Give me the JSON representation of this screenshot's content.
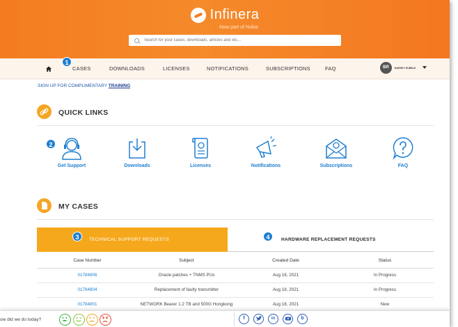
{
  "brand": {
    "logo_text": "Infinera",
    "subtitle": "Now part of Nokia"
  },
  "search": {
    "placeholder": "Search for your cases, downloads, articles and etc..."
  },
  "nav": {
    "items": [
      {
        "label": "CASES"
      },
      {
        "label": "DOWNLOADS"
      },
      {
        "label": "LICENSES"
      },
      {
        "label": "NOTIFICATIONS"
      },
      {
        "label": "SUBSCRIPTIONS"
      },
      {
        "label": "FAQ"
      }
    ],
    "user_initials": "BR",
    "user_name": "BARNEY RUBBLE"
  },
  "signup": {
    "text": "SIGN UP FOR COMPLIMENTARY ",
    "link": "TRAINING"
  },
  "quick_links": {
    "title": "QUICK LINKS",
    "items": [
      {
        "label": "Get Support",
        "icon": "headset-agent-icon"
      },
      {
        "label": "Downloads",
        "icon": "download-icon"
      },
      {
        "label": "Licenses",
        "icon": "license-scroll-icon"
      },
      {
        "label": "Notifications",
        "icon": "megaphone-icon"
      },
      {
        "label": "Subscriptions",
        "icon": "envelope-icon"
      },
      {
        "label": "FAQ",
        "icon": "question-bubble-icon"
      }
    ]
  },
  "my_cases": {
    "title": "MY CASES",
    "tabs": [
      {
        "label": "TECHNICAL SUPPORT REQUESTS",
        "active": true
      },
      {
        "label": "HARDWARE REPLACEMENT REQUESTS",
        "active": false
      }
    ],
    "columns": [
      "Case Number",
      "Subject",
      "Created Date",
      "Status"
    ],
    "rows": [
      {
        "case": "01784806",
        "subject": "Oracle patches + TNMS PUs",
        "date": "Aug 18, 2021",
        "status": "In Progress"
      },
      {
        "case": "01784804",
        "subject": "Replacement of faulty transmitter",
        "date": "Aug 18, 2021",
        "status": "In Progress"
      },
      {
        "case": "01784801",
        "subject": "NETWORK Bearer 1.2 TB and 500G Hongkong",
        "date": "Aug 18, 2021",
        "status": "New"
      }
    ]
  },
  "annotations": [
    "1",
    "2",
    "3",
    "4"
  ],
  "footer": {
    "question": "ow did we do today?",
    "social": [
      "f",
      "t",
      "in",
      "yt",
      "b"
    ]
  },
  "colors": {
    "brand_orange": "#f47c20",
    "accent_yellow": "#f5a81c",
    "link_blue": "#1e7fd1",
    "badge_blue": "#1e7fd1"
  }
}
